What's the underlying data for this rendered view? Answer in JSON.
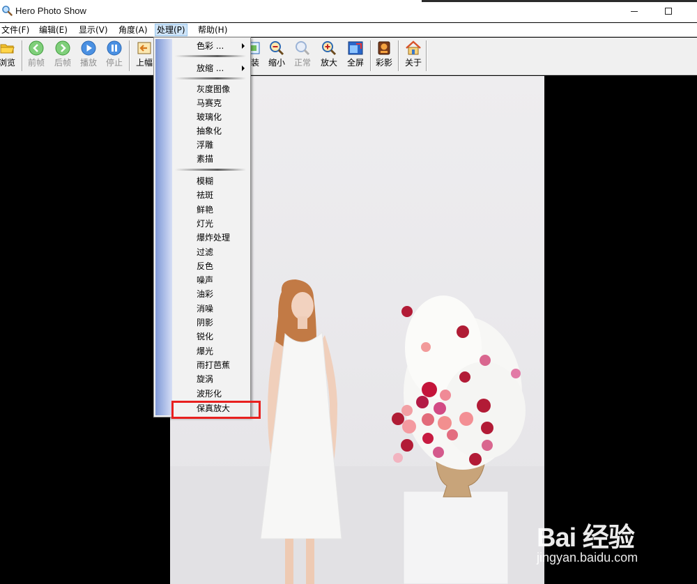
{
  "window": {
    "title": "Hero Photo Show"
  },
  "menubar": {
    "items": [
      {
        "label": "文件(F)"
      },
      {
        "label": "编辑(E)"
      },
      {
        "label": "显示(V)"
      },
      {
        "label": "角度(A)"
      },
      {
        "label": "处理(P)"
      },
      {
        "label": "帮助(H)"
      }
    ],
    "active_index": 4
  },
  "toolbar": {
    "buttons": [
      {
        "label": "浏览",
        "icon": "folder-icon",
        "enabled": true
      },
      {
        "label": "前帧",
        "icon": "back-arrow-icon",
        "enabled": false
      },
      {
        "label": "后帧",
        "icon": "forward-arrow-icon",
        "enabled": false
      },
      {
        "label": "播放",
        "icon": "play-icon",
        "enabled": false
      },
      {
        "label": "停止",
        "icon": "pause-icon",
        "enabled": false
      },
      {
        "label": "上幅",
        "icon": "previous-image-icon",
        "enabled": true
      },
      {
        "label": "装",
        "icon": "fit-icon",
        "enabled": true
      },
      {
        "label": "缩小",
        "icon": "zoom-out-icon",
        "enabled": true
      },
      {
        "label": "正常",
        "icon": "zoom-normal-icon",
        "enabled": false
      },
      {
        "label": "放大",
        "icon": "zoom-in-icon",
        "enabled": true
      },
      {
        "label": "全屏",
        "icon": "fullscreen-icon",
        "enabled": true
      },
      {
        "label": "彩影",
        "icon": "color-shadow-icon",
        "enabled": true
      },
      {
        "label": "关于",
        "icon": "home-icon",
        "enabled": true
      }
    ]
  },
  "process_menu": {
    "group1": [
      {
        "label": "色彩 ...",
        "submenu": true
      }
    ],
    "group2": [
      {
        "label": "放缩 ...",
        "submenu": true
      }
    ],
    "group3": [
      {
        "label": "灰度图像"
      },
      {
        "label": "马赛克"
      },
      {
        "label": "玻璃化"
      },
      {
        "label": "抽象化"
      },
      {
        "label": "浮雕"
      },
      {
        "label": "素描"
      }
    ],
    "group4": [
      {
        "label": "模糊"
      },
      {
        "label": "祛斑"
      },
      {
        "label": "鲜艳"
      },
      {
        "label": "灯光"
      },
      {
        "label": "爆炸处理"
      },
      {
        "label": "过滤"
      },
      {
        "label": "反色"
      },
      {
        "label": "噪声"
      },
      {
        "label": "油彩"
      },
      {
        "label": "消噪"
      },
      {
        "label": "阴影"
      },
      {
        "label": "锐化"
      },
      {
        "label": "爆光"
      },
      {
        "label": "雨打芭蕉"
      },
      {
        "label": "旋涡"
      },
      {
        "label": "波形化"
      },
      {
        "label": "保真放大"
      }
    ],
    "highlighted_item": "保真放大",
    "highlight_color": "#e8201f"
  },
  "watermark": {
    "logo": "Bai 经验",
    "url": "jingyan.baidu.com"
  },
  "colors": {
    "menu_gutter": "#8fa6dc",
    "active_menu_bg": "#cde3f7",
    "canvas_bg": "#000000"
  }
}
